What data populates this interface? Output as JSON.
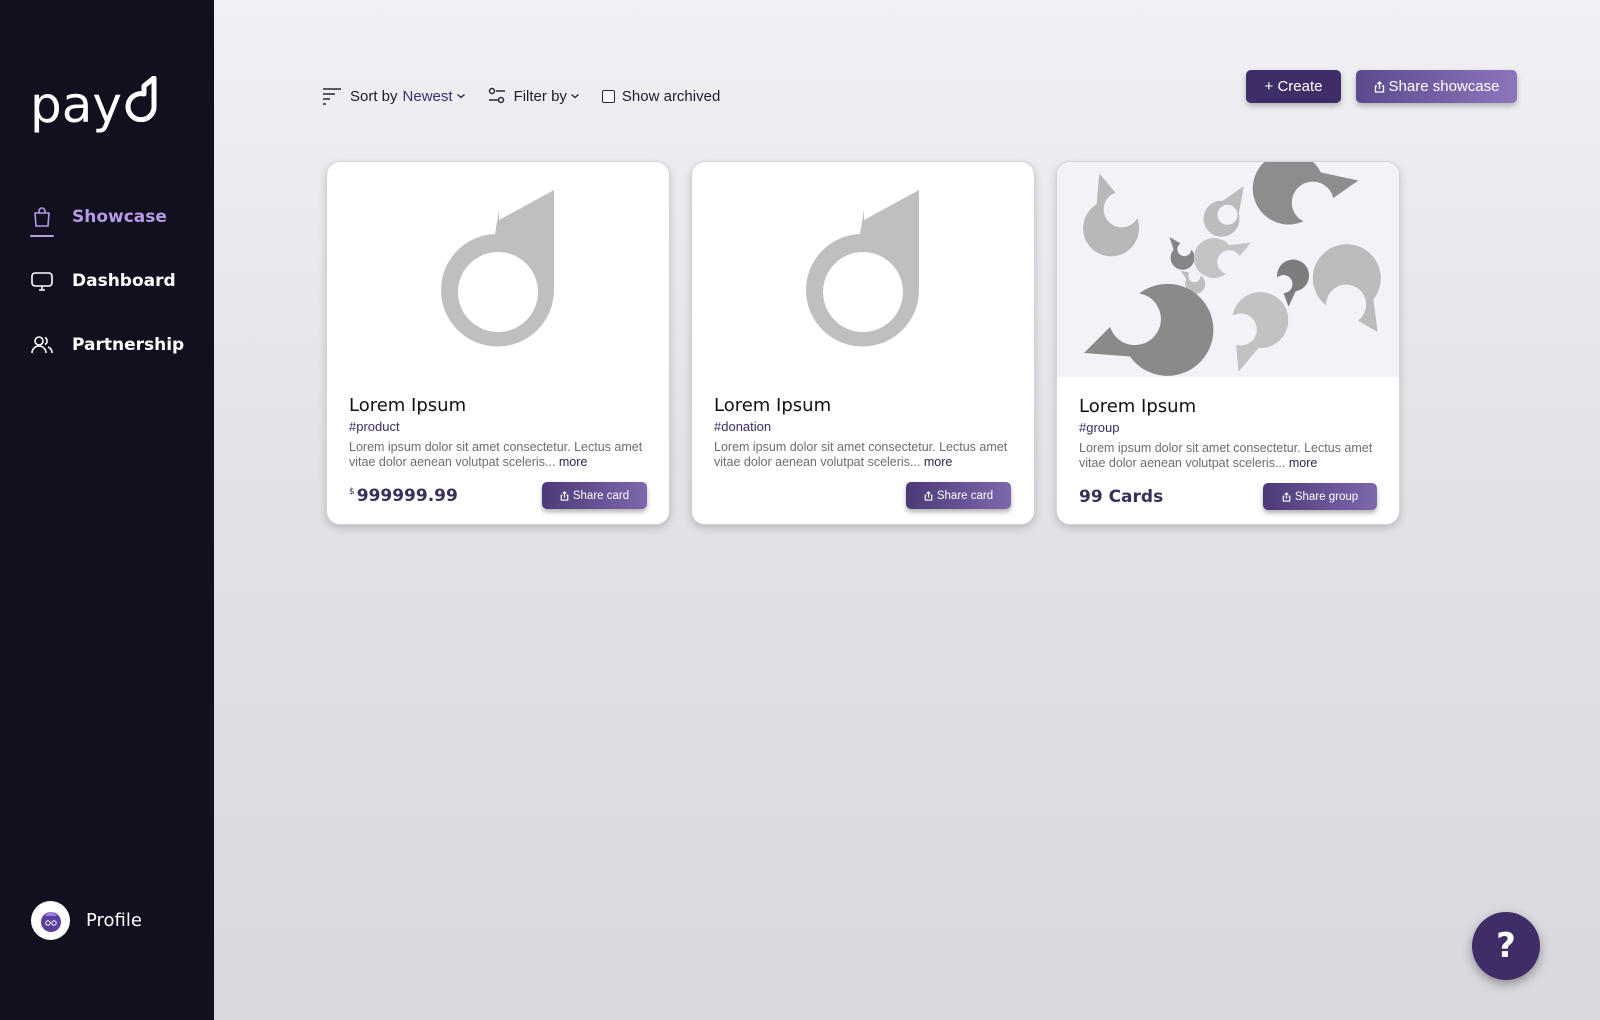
{
  "sidebar": {
    "logo_text": "pay",
    "items": [
      {
        "label": "Showcase",
        "icon": "shopping-bag-icon",
        "active": true
      },
      {
        "label": "Dashboard",
        "icon": "monitor-icon",
        "active": false
      },
      {
        "label": "Partnership",
        "icon": "users-icon",
        "active": false
      }
    ],
    "profile_label": "Profile"
  },
  "toolbar": {
    "sort_label": "Sort by",
    "sort_value": "Newest",
    "filter_label": "Filter by",
    "archived_label": "Show archived",
    "archived_checked": false,
    "create_label": "+ Create",
    "share_showcase_label": "Share showcase"
  },
  "cards": [
    {
      "title": "Lorem Ipsum",
      "tag": "#product",
      "description": "Lorem ipsum dolor sit amet consectetur. Lectus amet vitae dolor aenean volutpat sceleris...",
      "more": "more",
      "currency": "$",
      "price": "999999.99",
      "button": "Share card"
    },
    {
      "title": "Lorem Ipsum",
      "tag": "#donation",
      "description": "Lorem ipsum dolor sit amet consectetur. Lectus amet vitae dolor aenean volutpat sceleris...",
      "more": "more",
      "button": "Share card"
    },
    {
      "title": "Lorem Ipsum",
      "tag": "#group",
      "description": "Lorem ipsum dolor sit amet consectetur. Lectus amet vitae dolor aenean volutpat sceleris...",
      "more": "more",
      "count": "99 Cards",
      "button": "Share group"
    }
  ],
  "help_label": "?",
  "colors": {
    "sidebar_bg": "#120f1e",
    "accent": "#3f2d68",
    "active_nav": "#b49ae8"
  }
}
